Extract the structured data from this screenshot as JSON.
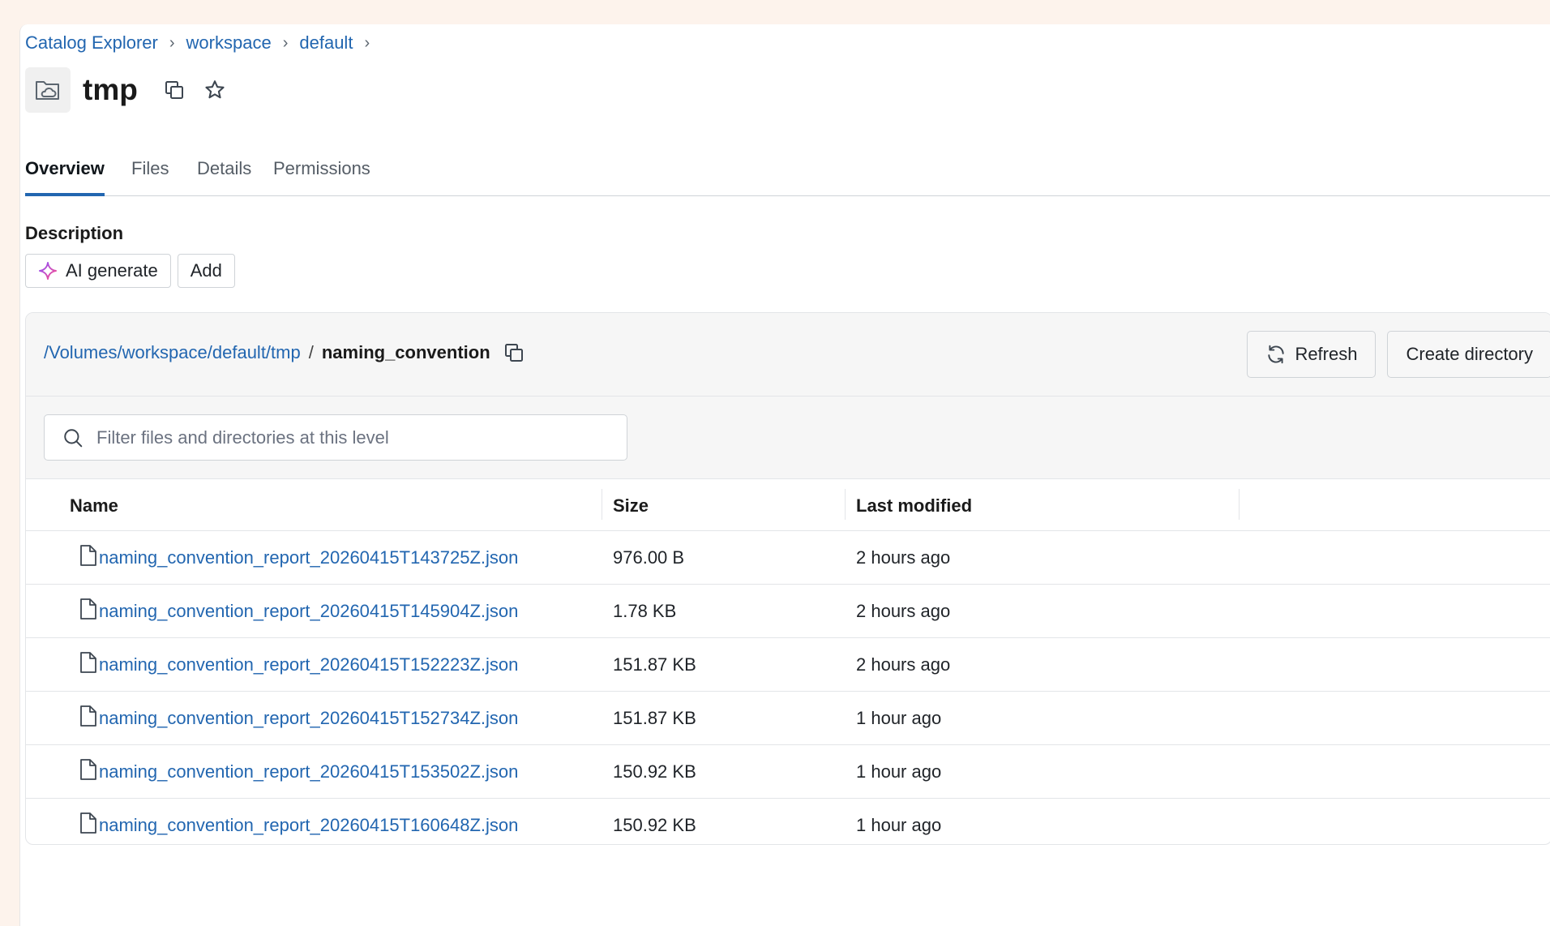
{
  "breadcrumb": {
    "items": [
      {
        "label": "Catalog Explorer"
      },
      {
        "label": "workspace"
      },
      {
        "label": "default"
      }
    ]
  },
  "title": {
    "name": "tmp",
    "volume_icon": "cloud-folder-icon",
    "copy_icon": "copy-icon",
    "star_icon": "star-icon"
  },
  "tabs": [
    {
      "label": "Overview",
      "active": true
    },
    {
      "label": "Files",
      "active": false
    },
    {
      "label": "Details",
      "active": false
    },
    {
      "label": "Permissions",
      "active": false
    }
  ],
  "description": {
    "label": "Description",
    "ai_generate_label": "AI generate",
    "add_label": "Add"
  },
  "browser": {
    "path_link": "/Volumes/workspace/default/tmp",
    "path_separator": "/",
    "path_current": "naming_convention",
    "refresh_label": "Refresh",
    "create_directory_label": "Create directory",
    "filter_placeholder": "Filter files and directories at this level",
    "columns": {
      "name": "Name",
      "size": "Size",
      "modified": "Last modified"
    },
    "rows": [
      {
        "name": "naming_convention_report_20260415T143725Z.json",
        "size": "976.00 B",
        "modified": "2 hours ago"
      },
      {
        "name": "naming_convention_report_20260415T145904Z.json",
        "size": "1.78 KB",
        "modified": "2 hours ago"
      },
      {
        "name": "naming_convention_report_20260415T152223Z.json",
        "size": "151.87 KB",
        "modified": "2 hours ago"
      },
      {
        "name": "naming_convention_report_20260415T152734Z.json",
        "size": "151.87 KB",
        "modified": "1 hour ago"
      },
      {
        "name": "naming_convention_report_20260415T153502Z.json",
        "size": "150.92 KB",
        "modified": "1 hour ago"
      },
      {
        "name": "naming_convention_report_20260415T160648Z.json",
        "size": "150.92 KB",
        "modified": "1 hour ago"
      }
    ]
  },
  "colors": {
    "link": "#2266b0",
    "page_bg": "#fdf3ec",
    "ai_sparkle_start": "#8a4fff",
    "ai_sparkle_end": "#ff4f8b"
  }
}
